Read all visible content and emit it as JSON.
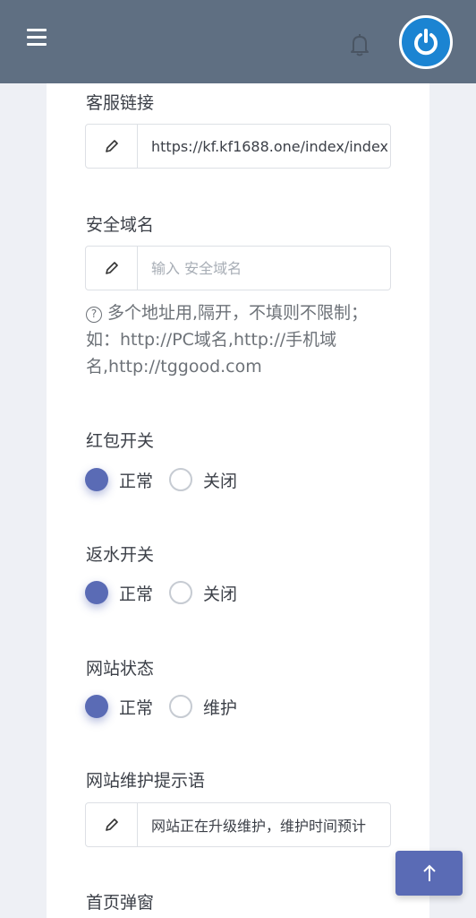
{
  "header": {
    "menu_icon": "hamburger-menu-icon",
    "bell_icon": "bell-icon",
    "power_icon": "power-icon"
  },
  "fields": {
    "customer_service_link": {
      "label": "客服链接",
      "value": "https://kf.kf1688.one/index/index",
      "icon": "pencil-icon"
    },
    "secure_domain": {
      "label": "安全域名",
      "value": "",
      "placeholder": "输入 安全域名",
      "icon": "pencil-icon",
      "help": "多个地址用,隔开，不填则不限制；如：http://PC域名,http://手机域名,http://tggood.com"
    },
    "red_packet_switch": {
      "label": "红包开关",
      "options": [
        "正常",
        "关闭"
      ],
      "selected": "正常"
    },
    "rebate_switch": {
      "label": "返水开关",
      "options": [
        "正常",
        "关闭"
      ],
      "selected": "正常"
    },
    "site_status": {
      "label": "网站状态",
      "options": [
        "正常",
        "维护"
      ],
      "selected": "正常"
    },
    "maintenance_message": {
      "label": "网站维护提示语",
      "value": "网站正在升级维护，维护时间预计",
      "icon": "pencil-icon"
    },
    "home_popup": {
      "label": "首页弹窗"
    }
  },
  "back_to_top_icon": "arrow-up-icon",
  "colors": {
    "header_bg": "#5f6f82",
    "accent": "#5a6bb5",
    "power_button": "#1b84d2"
  }
}
